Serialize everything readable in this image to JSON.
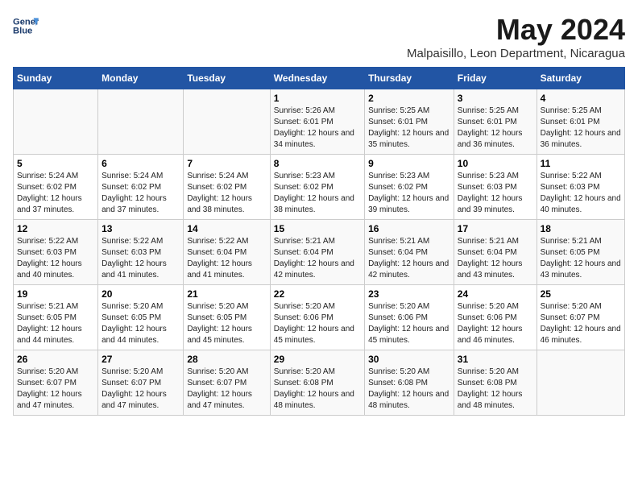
{
  "logo": {
    "line1": "General",
    "line2": "Blue"
  },
  "title": "May 2024",
  "subtitle": "Malpaisillo, Leon Department, Nicaragua",
  "days_header": [
    "Sunday",
    "Monday",
    "Tuesday",
    "Wednesday",
    "Thursday",
    "Friday",
    "Saturday"
  ],
  "weeks": [
    [
      {
        "num": "",
        "sunrise": "",
        "sunset": "",
        "daylight": ""
      },
      {
        "num": "",
        "sunrise": "",
        "sunset": "",
        "daylight": ""
      },
      {
        "num": "",
        "sunrise": "",
        "sunset": "",
        "daylight": ""
      },
      {
        "num": "1",
        "sunrise": "Sunrise: 5:26 AM",
        "sunset": "Sunset: 6:01 PM",
        "daylight": "Daylight: 12 hours and 34 minutes."
      },
      {
        "num": "2",
        "sunrise": "Sunrise: 5:25 AM",
        "sunset": "Sunset: 6:01 PM",
        "daylight": "Daylight: 12 hours and 35 minutes."
      },
      {
        "num": "3",
        "sunrise": "Sunrise: 5:25 AM",
        "sunset": "Sunset: 6:01 PM",
        "daylight": "Daylight: 12 hours and 36 minutes."
      },
      {
        "num": "4",
        "sunrise": "Sunrise: 5:25 AM",
        "sunset": "Sunset: 6:01 PM",
        "daylight": "Daylight: 12 hours and 36 minutes."
      }
    ],
    [
      {
        "num": "5",
        "sunrise": "Sunrise: 5:24 AM",
        "sunset": "Sunset: 6:02 PM",
        "daylight": "Daylight: 12 hours and 37 minutes."
      },
      {
        "num": "6",
        "sunrise": "Sunrise: 5:24 AM",
        "sunset": "Sunset: 6:02 PM",
        "daylight": "Daylight: 12 hours and 37 minutes."
      },
      {
        "num": "7",
        "sunrise": "Sunrise: 5:24 AM",
        "sunset": "Sunset: 6:02 PM",
        "daylight": "Daylight: 12 hours and 38 minutes."
      },
      {
        "num": "8",
        "sunrise": "Sunrise: 5:23 AM",
        "sunset": "Sunset: 6:02 PM",
        "daylight": "Daylight: 12 hours and 38 minutes."
      },
      {
        "num": "9",
        "sunrise": "Sunrise: 5:23 AM",
        "sunset": "Sunset: 6:02 PM",
        "daylight": "Daylight: 12 hours and 39 minutes."
      },
      {
        "num": "10",
        "sunrise": "Sunrise: 5:23 AM",
        "sunset": "Sunset: 6:03 PM",
        "daylight": "Daylight: 12 hours and 39 minutes."
      },
      {
        "num": "11",
        "sunrise": "Sunrise: 5:22 AM",
        "sunset": "Sunset: 6:03 PM",
        "daylight": "Daylight: 12 hours and 40 minutes."
      }
    ],
    [
      {
        "num": "12",
        "sunrise": "Sunrise: 5:22 AM",
        "sunset": "Sunset: 6:03 PM",
        "daylight": "Daylight: 12 hours and 40 minutes."
      },
      {
        "num": "13",
        "sunrise": "Sunrise: 5:22 AM",
        "sunset": "Sunset: 6:03 PM",
        "daylight": "Daylight: 12 hours and 41 minutes."
      },
      {
        "num": "14",
        "sunrise": "Sunrise: 5:22 AM",
        "sunset": "Sunset: 6:04 PM",
        "daylight": "Daylight: 12 hours and 41 minutes."
      },
      {
        "num": "15",
        "sunrise": "Sunrise: 5:21 AM",
        "sunset": "Sunset: 6:04 PM",
        "daylight": "Daylight: 12 hours and 42 minutes."
      },
      {
        "num": "16",
        "sunrise": "Sunrise: 5:21 AM",
        "sunset": "Sunset: 6:04 PM",
        "daylight": "Daylight: 12 hours and 42 minutes."
      },
      {
        "num": "17",
        "sunrise": "Sunrise: 5:21 AM",
        "sunset": "Sunset: 6:04 PM",
        "daylight": "Daylight: 12 hours and 43 minutes."
      },
      {
        "num": "18",
        "sunrise": "Sunrise: 5:21 AM",
        "sunset": "Sunset: 6:05 PM",
        "daylight": "Daylight: 12 hours and 43 minutes."
      }
    ],
    [
      {
        "num": "19",
        "sunrise": "Sunrise: 5:21 AM",
        "sunset": "Sunset: 6:05 PM",
        "daylight": "Daylight: 12 hours and 44 minutes."
      },
      {
        "num": "20",
        "sunrise": "Sunrise: 5:20 AM",
        "sunset": "Sunset: 6:05 PM",
        "daylight": "Daylight: 12 hours and 44 minutes."
      },
      {
        "num": "21",
        "sunrise": "Sunrise: 5:20 AM",
        "sunset": "Sunset: 6:05 PM",
        "daylight": "Daylight: 12 hours and 45 minutes."
      },
      {
        "num": "22",
        "sunrise": "Sunrise: 5:20 AM",
        "sunset": "Sunset: 6:06 PM",
        "daylight": "Daylight: 12 hours and 45 minutes."
      },
      {
        "num": "23",
        "sunrise": "Sunrise: 5:20 AM",
        "sunset": "Sunset: 6:06 PM",
        "daylight": "Daylight: 12 hours and 45 minutes."
      },
      {
        "num": "24",
        "sunrise": "Sunrise: 5:20 AM",
        "sunset": "Sunset: 6:06 PM",
        "daylight": "Daylight: 12 hours and 46 minutes."
      },
      {
        "num": "25",
        "sunrise": "Sunrise: 5:20 AM",
        "sunset": "Sunset: 6:07 PM",
        "daylight": "Daylight: 12 hours and 46 minutes."
      }
    ],
    [
      {
        "num": "26",
        "sunrise": "Sunrise: 5:20 AM",
        "sunset": "Sunset: 6:07 PM",
        "daylight": "Daylight: 12 hours and 47 minutes."
      },
      {
        "num": "27",
        "sunrise": "Sunrise: 5:20 AM",
        "sunset": "Sunset: 6:07 PM",
        "daylight": "Daylight: 12 hours and 47 minutes."
      },
      {
        "num": "28",
        "sunrise": "Sunrise: 5:20 AM",
        "sunset": "Sunset: 6:07 PM",
        "daylight": "Daylight: 12 hours and 47 minutes."
      },
      {
        "num": "29",
        "sunrise": "Sunrise: 5:20 AM",
        "sunset": "Sunset: 6:08 PM",
        "daylight": "Daylight: 12 hours and 48 minutes."
      },
      {
        "num": "30",
        "sunrise": "Sunrise: 5:20 AM",
        "sunset": "Sunset: 6:08 PM",
        "daylight": "Daylight: 12 hours and 48 minutes."
      },
      {
        "num": "31",
        "sunrise": "Sunrise: 5:20 AM",
        "sunset": "Sunset: 6:08 PM",
        "daylight": "Daylight: 12 hours and 48 minutes."
      },
      {
        "num": "",
        "sunrise": "",
        "sunset": "",
        "daylight": ""
      }
    ]
  ]
}
